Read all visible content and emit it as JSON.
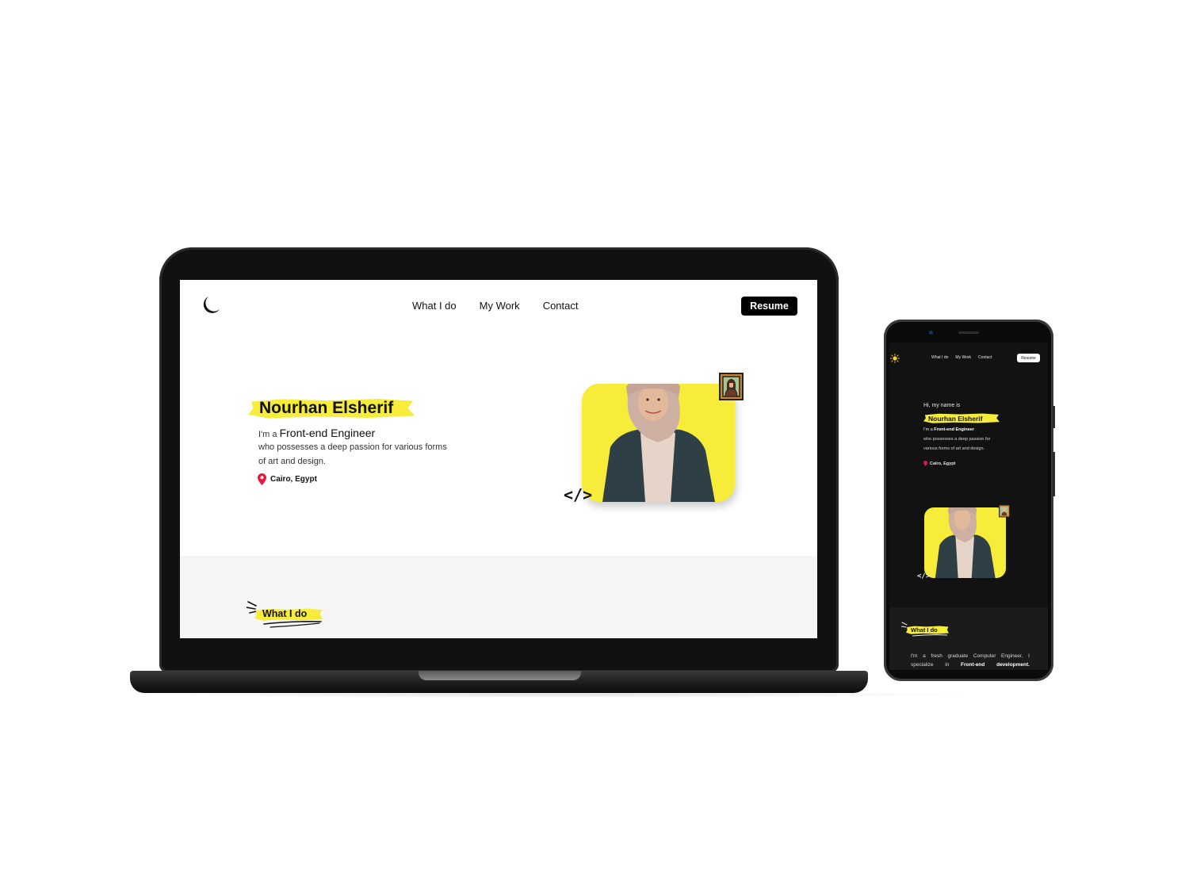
{
  "colors": {
    "accent_yellow": "#f6ec39",
    "location_pin": "#e8173f",
    "dark_bg": "#121212",
    "light_section_bg": "#f5f5f5"
  },
  "desktop": {
    "logo_icon": "crescent-moon-icon",
    "nav": [
      "What I do",
      "My Work",
      "Contact"
    ],
    "resume_label": "Resume",
    "hero": {
      "name": "Nourhan Elsherif",
      "intro_prefix": "I'm a",
      "role": "Front-end Engineer",
      "desc_line1": "who possesses a deep passion for various forms",
      "desc_line2": "of art and design.",
      "location": "Cairo, Egypt",
      "code_symbol": "</>"
    },
    "section_title": "What I do"
  },
  "mobile": {
    "theme_icon": "sun-icon",
    "nav": [
      "What I do",
      "My Work",
      "Contact"
    ],
    "resume_label": "Resume",
    "hero": {
      "greeting": "Hi, my name is",
      "name": "Nourhan Elsherif",
      "intro_prefix": "I'm a",
      "role": "Front-end Engineer",
      "desc_line1": "who possesses a deep passion for",
      "desc_line2": "various forms of art and design.",
      "location": "Cairo, Egypt",
      "code_symbol": "</>"
    },
    "section_title": "What I do",
    "body_line1": "I'm a fresh graduate Computer Engineer, I",
    "body_line2_a": "specialize",
    "body_line2_b": "in",
    "body_line2_c": "Front-end",
    "body_line2_d": "development."
  }
}
